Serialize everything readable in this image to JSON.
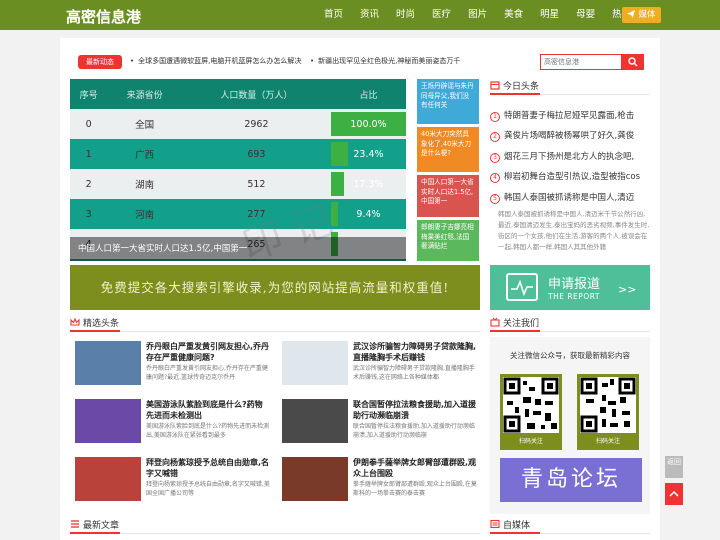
{
  "header": {
    "logo": "高密信息港",
    "nav": [
      "首页",
      "资讯",
      "时尚",
      "医疗",
      "图片",
      "美食",
      "明星",
      "母婴",
      "热点"
    ],
    "media_button": "媒体",
    "colors": {
      "bar": "#6b8e23",
      "accent": "#f0ad21"
    }
  },
  "ticker": {
    "badge": "最新动态",
    "items": [
      "全球多国遭遇微软蓝屏,电脑开机蓝屏怎么办怎么解决",
      "新疆出现罕见全红色极光,神秘而美丽姿态万千"
    ]
  },
  "search": {
    "placeholder": "高密信息港"
  },
  "hero": {
    "headers": [
      "序号",
      "来源省份",
      "人口数量（万人）",
      "占比"
    ],
    "rows": [
      {
        "idx": "0",
        "prov": "全国",
        "pop": "2962",
        "pct": "100.0%",
        "frac": 1.0
      },
      {
        "idx": "1",
        "prov": "广西",
        "pop": "693",
        "pct": "23.4%",
        "frac": 0.234
      },
      {
        "idx": "2",
        "prov": "湖南",
        "pop": "512",
        "pct": "17.3%",
        "frac": 0.173
      },
      {
        "idx": "3",
        "prov": "河南",
        "pop": "277",
        "pct": "9.4%",
        "frac": 0.094
      },
      {
        "idx": "4",
        "prov": "",
        "pop": "265",
        "pct": "",
        "frac": 0.089
      }
    ],
    "caption": "中国人口第一大省实时人口达1.5亿,中国第一"
  },
  "tiles": [
    {
      "text": "王烁丹辟谣与朱丹同母异父,我们没有任何关",
      "color": "#3fa9d8"
    },
    {
      "text": "40米大刀突然具象化了,40米大刀是什么梗?",
      "color": "#f08a24"
    },
    {
      "text": "中国人口第一大省实时人口达1.5亿,中国第一",
      "color": "#d9534f"
    },
    {
      "text": "郎朗妻子吉娜亮相梅果美红毯,法国奢满贴烂",
      "color": "#5cb85c"
    }
  ],
  "today": {
    "title": "今日头条",
    "items": [
      "特朗普妻子梅拉尼娅罕见露面,枪击",
      "龚俊片场喝醉被杨幂哄了好久,龚俊",
      "烟花三月下扬州是北方人的执念吧,",
      "柳岩初舞台造型引热议,造型被指cos",
      "韩国人泰国被抓诱称是中国人,清迈"
    ],
    "desc": "韩国人泰国被抓诱称是中国人,清迈米千节公然行凶,最近,泰国清迈发生,泰出宝妈的恶劣视频,事件发生时,街区的一个女孩,他们在生活,游客的两个人,被误会在一起,韩国人都一样,韩国人其其他外籍"
  },
  "banner": {
    "left_text": "免费提交各大搜索引擎收录,为您的网站提高流量和权重值!",
    "right_title": "申请报道",
    "right_sub": "THE REPORT",
    "right_arrows": ">>"
  },
  "featured": {
    "title": "精选头条",
    "articles": [
      {
        "title": "乔丹眼白严重发黄引网友担心,乔丹存在严重健康问题?",
        "desc": "乔丹眼白严重发黄引网友担心,乔丹存在严重健康问题?最近,篮球传奇迈克尔乔丹",
        "color": "#5a7fa8"
      },
      {
        "title": "武汉诊所骗智力障碍男子贷款隆胸,直播隆胸手术后赚钱",
        "desc": "武汉诊所骗智力障碍男子贷款隆胸,直播隆胸手术后赚钱,这在网络上各种媒体都",
        "color": "#a9b8c4"
      },
      {
        "title": "美国游泳队紫脸到底是什么?药物先进而未检测出",
        "desc": "美国游泳队紫脸到底是什么?药物先进而未检测出,美国游泳队在紧张看到最多",
        "color": "#6a4aa6"
      },
      {
        "title": "联合国暂停拉法粮食援助,加入道援助行动濒临崩溃",
        "desc": "联合国暂停拉法粮食援助,加入道援助行动濒临崩溃,加入道援助行动濒临崩",
        "color": "#4a4a4a"
      },
      {
        "title": "拜登向杨紫琼授予总统自由勋章,名字又喊错",
        "desc": "拜登向杨紫琼授予总统自由勋章,名字又喊错,美国全国广播公司等",
        "color": "#b9423a"
      },
      {
        "title": "伊朗拳手薩举牌女郎臂部遭群殴,观众上台围殴",
        "desc": "拳手薩举牌女郎臂部遭群殴,观众上台围殴,在莫斯科的一场拳击赛的泰击赛",
        "color": "#7a3a2a"
      }
    ]
  },
  "follow": {
    "title": "关注我们",
    "text": "关注微信公众号，获取最新精彩内容",
    "qr_label": "扫码关注",
    "forum": "青岛论坛"
  },
  "latest": {
    "title": "最新文章"
  },
  "self_media": {
    "title": "自媒体"
  },
  "float": {
    "item1": "返回",
    "item2": "顶部"
  }
}
